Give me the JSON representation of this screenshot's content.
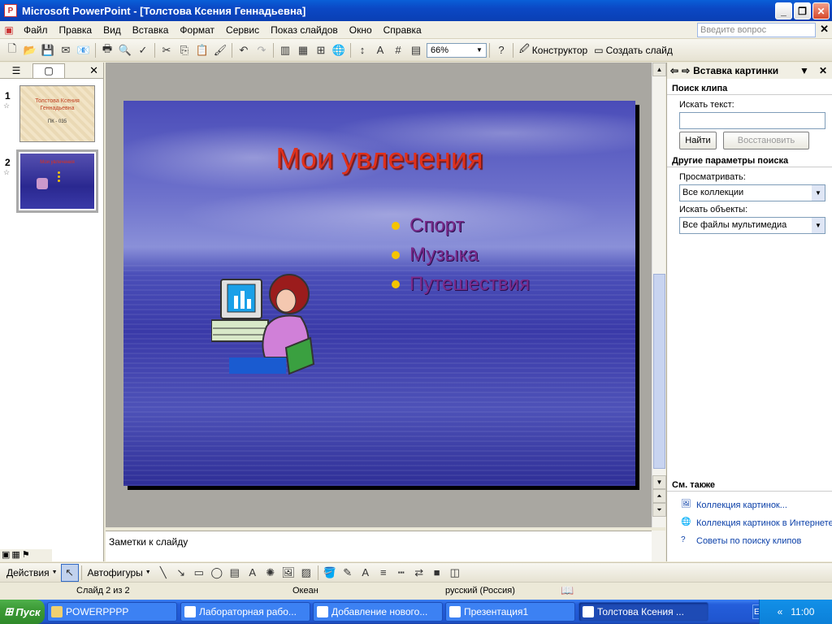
{
  "window": {
    "title": "Microsoft PowerPoint - [Толстова Ксения Геннадьевна]",
    "app_icon": "P"
  },
  "menu": {
    "items": [
      "Файл",
      "Правка",
      "Вид",
      "Вставка",
      "Формат",
      "Сервис",
      "Показ слайдов",
      "Окно",
      "Справка"
    ],
    "help_placeholder": "Введите вопрос"
  },
  "toolbar": {
    "zoom": "66%",
    "designer_label": "Конструктор",
    "new_slide_label": "Создать слайд"
  },
  "thumbnails": [
    {
      "number": "1",
      "title": "Толстова Ксения Геннадьевна",
      "subtitle": "ПК - 035"
    },
    {
      "number": "2",
      "title": "Мои увлечения"
    }
  ],
  "slide": {
    "title": "Мои увлечения",
    "bullets": [
      "Спорт",
      "Музыка",
      "Путешествия"
    ]
  },
  "notes": {
    "placeholder": "Заметки к слайду"
  },
  "task_pane": {
    "title": "Вставка картинки",
    "search_section": "Поиск клипа",
    "search_text_label": "Искать текст:",
    "search_value": "",
    "find_button": "Найти",
    "restore_button": "Восстановить",
    "other_options": "Другие параметры поиска",
    "browse_label": "Просматривать:",
    "browse_value": "Все коллекции",
    "objects_label": "Искать объекты:",
    "objects_value": "Все файлы мультимедиа",
    "see_also": "См. также",
    "links": [
      "Коллекция картинок...",
      "Коллекция картинок в Интернете",
      "Советы по поиску клипов"
    ]
  },
  "drawbar": {
    "actions_label": "Действия",
    "autoshapes_label": "Автофигуры"
  },
  "status": {
    "slide": "Слайд 2 из 2",
    "design": "Океан",
    "language": "русский (Россия)"
  },
  "taskbar": {
    "start": "Пуск",
    "tasks": [
      "POWERPPPP",
      "Лабораторная рабо...",
      "Добавление нового...",
      "Презентация1",
      "Толстова Ксения ..."
    ],
    "lang": "EN",
    "time": "11:00"
  },
  "colors": {
    "title_bar": "#0b48c4",
    "slide_title": "#e0301a",
    "bullet_text": "#7a2a8a",
    "bullet_dot": "#f5c400"
  }
}
